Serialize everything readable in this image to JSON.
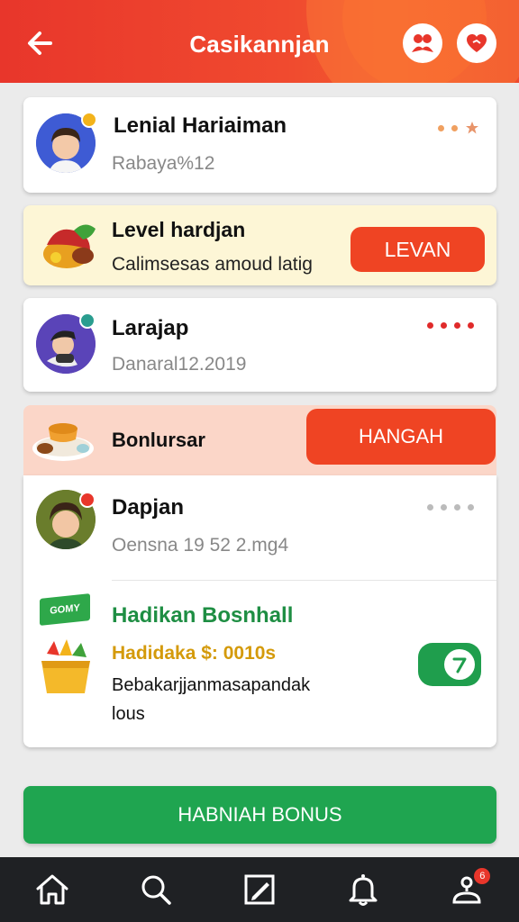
{
  "header": {
    "title": "Casikannjan",
    "back_icon": "arrow-left-icon",
    "action_icons": [
      "group-icon",
      "heart-icon"
    ],
    "color": "#e8362b"
  },
  "profile_card": {
    "name": "Lenial Hariaiman",
    "subtitle": "Rabaya%12",
    "menu_icon": "more-dots-star-icon"
  },
  "level_card": {
    "title": "Level hardjan",
    "subtitle": "Calimsesas amoud latig",
    "button_label": "LEVAN",
    "icon": "food-basket-icon",
    "background": "#fdf6d6"
  },
  "friend_card": {
    "name": "Larajap",
    "subtitle": "Danaral12.2019",
    "menu_icon": "more-dots-icon"
  },
  "bonus_card": {
    "title": "Bonlursar",
    "button_label": "HANGAH",
    "icon": "food-bowl-icon",
    "background": "#fbd8cc"
  },
  "details_card": {
    "user": {
      "name": "Dapjan",
      "subtitle": "Oensna 19 52 2.mg4",
      "menu_icon": "more-dots-icon"
    },
    "promo": {
      "tag": "GOMY",
      "title": "Hadikan Bosnhall",
      "amount": "Hadidaka $: 0010s",
      "description_line1": "Bebakarjjanmasapandak",
      "description_line2": "lous",
      "action_icon": "arrow-right-circle-icon"
    }
  },
  "primary_button": {
    "label": "HABNIAH BONUS",
    "color": "#1fa550"
  },
  "bottom_nav": {
    "items": [
      "home-icon",
      "search-icon",
      "edit-icon",
      "bell-icon",
      "profile-icon"
    ],
    "profile_badge": "6"
  }
}
